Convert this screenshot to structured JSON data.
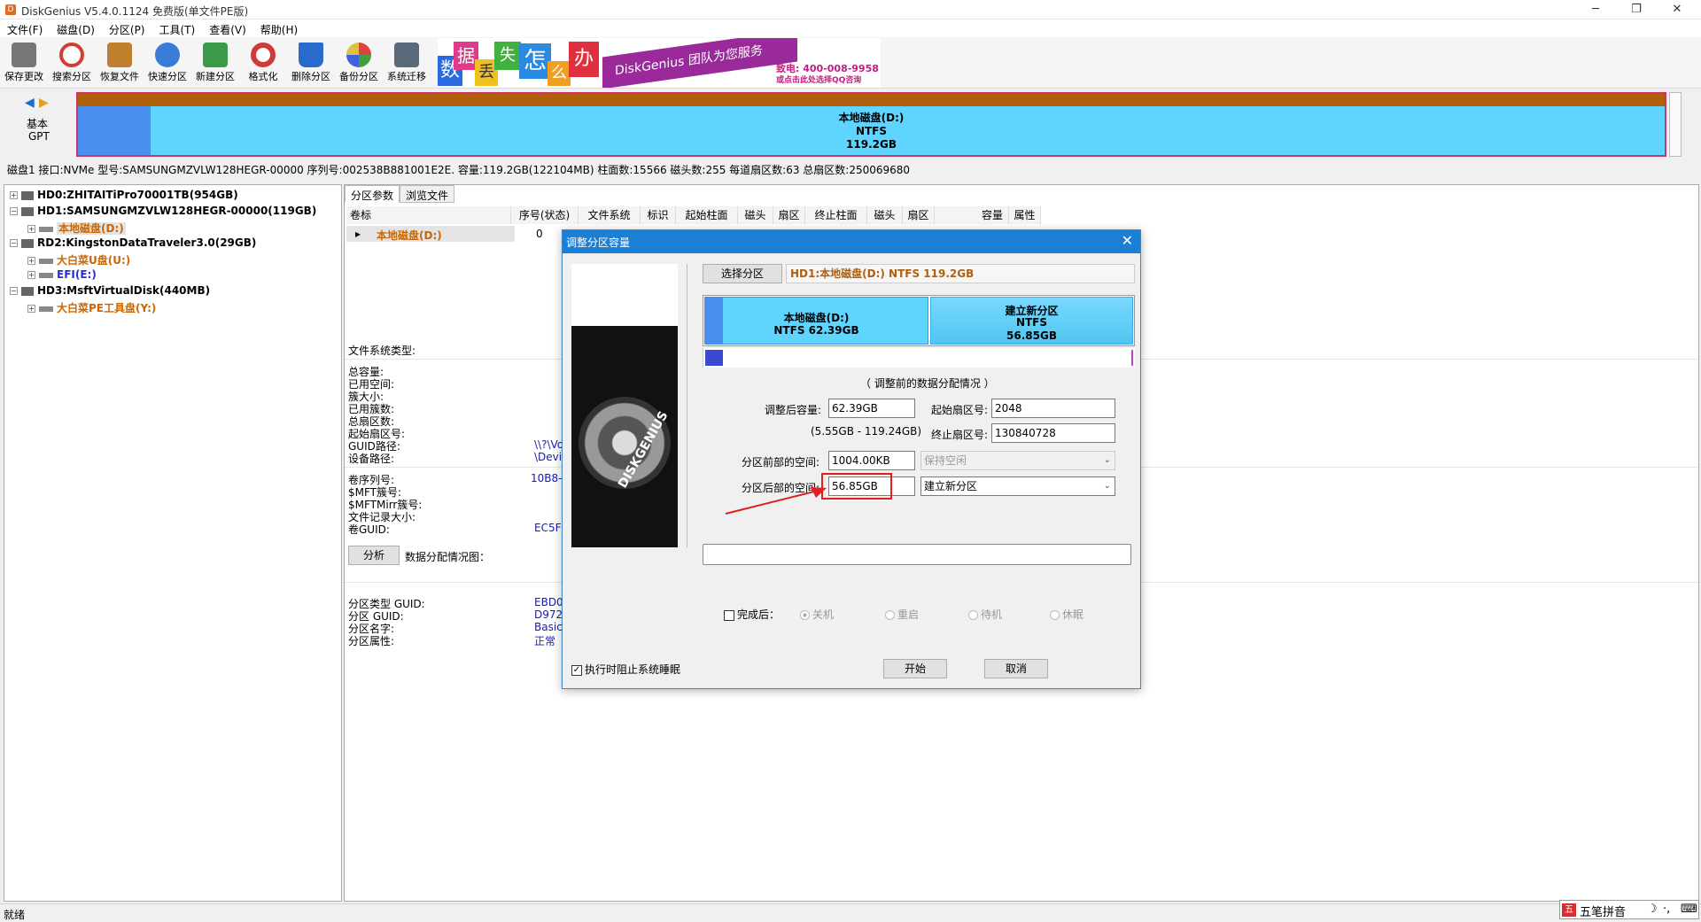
{
  "titlebar": {
    "title": "DiskGenius V5.4.0.1124 免费版(单文件PE版)"
  },
  "menu": [
    "文件(F)",
    "磁盘(D)",
    "分区(P)",
    "工具(T)",
    "查看(V)",
    "帮助(H)"
  ],
  "toolbar": [
    {
      "label": "保存更改",
      "icon": "save-icon",
      "color": "#777777"
    },
    {
      "label": "搜索分区",
      "icon": "search-icon",
      "color": "#d04030"
    },
    {
      "label": "恢复文件",
      "icon": "recover-file-icon",
      "color": "#c08030"
    },
    {
      "label": "快速分区",
      "icon": "quick-partition-icon",
      "color": "#3a7bd5"
    },
    {
      "label": "新建分区",
      "icon": "new-partition-icon",
      "color": "#3a9a4a"
    },
    {
      "label": "格式化",
      "icon": "format-icon",
      "color": "#d03a3a"
    },
    {
      "label": "删除分区",
      "icon": "delete-partition-icon",
      "color": "#2a6acc"
    },
    {
      "label": "备份分区",
      "icon": "backup-partition-icon",
      "color": "#c040c0"
    },
    {
      "label": "系统迁移",
      "icon": "system-migrate-icon",
      "color": "#5a6a7a"
    }
  ],
  "banner": {
    "chars": [
      "数",
      "据",
      "丢",
      "失",
      "怎",
      "么",
      "办"
    ],
    "ribbon": "DiskGenius 团队为您服务",
    "phone": "致电: 400-008-9958",
    "qq": "或点击此处选择QQ咨询"
  },
  "diskmap": {
    "nav_type": "基本",
    "nav_style": "GPT",
    "partition_name": "本地磁盘(D:)",
    "partition_fs": "NTFS",
    "partition_size": "119.2GB"
  },
  "disk_info": "磁盘1 接口:NVMe  型号:SAMSUNGMZVLW128HEGR-00000  序列号:002538B881001E2E.  容量:119.2GB(122104MB)  柱面数:15566  磁头数:255  每道扇区数:63  总扇区数:250069680",
  "tree": [
    {
      "label": "HD0:ZHITAITiPro70001TB(954GB)",
      "kind": "disk",
      "level": 0
    },
    {
      "label": "HD1:SAMSUNGMZVLW128HEGR-00000(119GB)",
      "kind": "disk",
      "level": 0
    },
    {
      "label": "本地磁盘(D:)",
      "kind": "part-selected",
      "level": 1
    },
    {
      "label": "RD2:KingstonDataTraveler3.0(29GB)",
      "kind": "disk",
      "level": 0
    },
    {
      "label": "大白菜U盘(U:)",
      "kind": "part-orange",
      "level": 1
    },
    {
      "label": "EFI(E:)",
      "kind": "part-blue",
      "level": 1
    },
    {
      "label": "HD3:MsftVirtualDisk(440MB)",
      "kind": "disk",
      "level": 0
    },
    {
      "label": "大白菜PE工具盘(Y:)",
      "kind": "part-orange",
      "level": 1
    }
  ],
  "tabs": [
    "分区参数",
    "浏览文件"
  ],
  "columns": [
    "卷标",
    "序号(状态)",
    "文件系统",
    "标识",
    "起始柱面",
    "磁头",
    "扇区",
    "终止柱面",
    "磁头",
    "扇区",
    "容量",
    "属性"
  ],
  "row": {
    "label": "本地磁盘(D:)",
    "index": "0"
  },
  "details": {
    "fs_type": "文件系统类型:",
    "group1": [
      "总容量:",
      "已用空间:",
      "簇大小:",
      "已用簇数:",
      "总扇区数:",
      "起始扇区号:",
      "GUID路径:",
      "设备路径:"
    ],
    "group1_vals": [
      "\\\\?\\Vo",
      "\\Devi"
    ],
    "group2": [
      "卷序列号:",
      "$MFT簇号:",
      "$MFTMirr簇号:",
      "文件记录大小:",
      "卷GUID:"
    ],
    "group2_vals": [
      "10B8-",
      "EC5F1"
    ],
    "analyze_btn": "分析",
    "analyze_label": "数据分配情况图：",
    "group3": [
      "分区类型 GUID:",
      "分区 GUID:",
      "分区名字:",
      "分区属性:"
    ],
    "group3_vals": [
      "EBD0",
      "D972",
      "Basic",
      "正常"
    ]
  },
  "dialog": {
    "title": "调整分区容量",
    "select_btn": "选择分区",
    "selected_partition": "HD1:本地磁盘(D:) NTFS 119.2GB",
    "part_left": {
      "name": "本地磁盘(D:)",
      "info": "NTFS 62.39GB"
    },
    "part_right": {
      "name": "建立新分区",
      "fs": "NTFS",
      "size": "56.85GB"
    },
    "before_note": "（ 调整前的数据分配情况 ）",
    "after_size_label": "调整后容量:",
    "after_size_value": "62.39GB",
    "range_note": "(5.55GB - 119.24GB)",
    "start_sector_label": "起始扇区号:",
    "start_sector_value": "2048",
    "end_sector_label": "终止扇区号:",
    "end_sector_value": "130840728",
    "before_space_label": "分区前部的空间:",
    "before_space_value": "1004.00KB",
    "before_space_option": "保持空闲",
    "after_space_label": "分区后部的空间:",
    "after_space_value": "56.85GB",
    "after_space_option": "建立新分区",
    "after_done_label": "完成后：",
    "radios": [
      "关机",
      "重启",
      "待机",
      "休眠"
    ],
    "prevent_sleep_label": "执行时阻止系统睡眠",
    "start_btn": "开始",
    "cancel_btn": "取消",
    "image_text": "DISKGENIUS"
  },
  "status": {
    "text": "就绪"
  },
  "ime": {
    "label": "五笔拼音"
  },
  "colors": {
    "accent": "#1c7fd6",
    "partition_bar": "#5fd4ff",
    "border_pink": "#cc3366",
    "orange": "#cc6600",
    "annotation_red": "#e02020"
  }
}
